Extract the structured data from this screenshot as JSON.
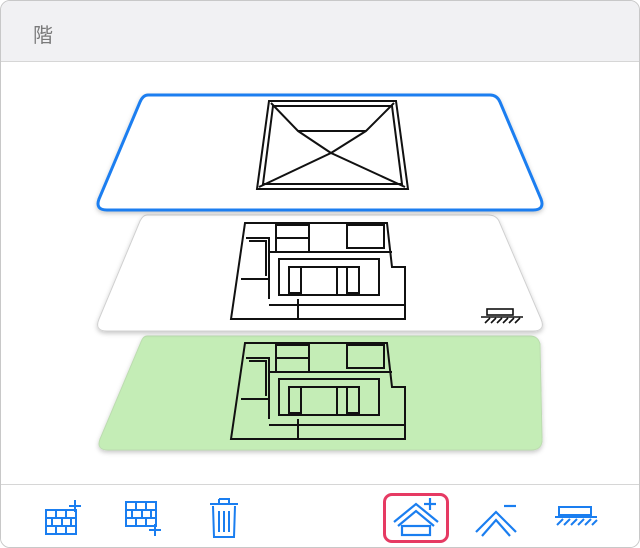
{
  "panel": {
    "title": "階"
  },
  "floors": [
    {
      "id": "roof",
      "selected": true,
      "fill": "#ffffff",
      "border": "#1a7ef0"
    },
    {
      "id": "floor-2",
      "selected": false,
      "fill": "#ffffff",
      "border": "#d0d0d0"
    },
    {
      "id": "floor-1",
      "selected": false,
      "fill": "#c4edb6",
      "border": "#bcdcb0"
    }
  ],
  "toolbar": {
    "tools": [
      {
        "icon": "add-floor-above-icon"
      },
      {
        "icon": "add-floor-below-icon"
      },
      {
        "icon": "trash-icon"
      },
      {
        "icon": "add-roof-icon",
        "selected": true
      },
      {
        "icon": "remove-roof-icon"
      },
      {
        "icon": "foundation-icon"
      }
    ]
  },
  "colors": {
    "accent": "#1a7ef0",
    "selected_outline": "#e63a63",
    "ground": "#c4edb6"
  }
}
